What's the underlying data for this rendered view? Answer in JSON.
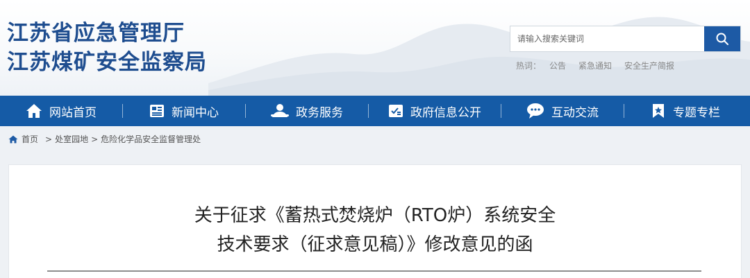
{
  "site": {
    "title_line1": "江苏省应急管理厅",
    "title_line2": "江苏煤矿安全监察局"
  },
  "search": {
    "placeholder": "请输入搜索关键词",
    "button_icon": "search-icon"
  },
  "hot_words": {
    "label": "热词：",
    "items": [
      "公告",
      "紧急通知",
      "安全生产简报"
    ]
  },
  "nav": {
    "items": [
      {
        "label": "网站首页",
        "icon": "home-icon"
      },
      {
        "label": "新闻中心",
        "icon": "news-icon"
      },
      {
        "label": "政务服务",
        "icon": "service-icon"
      },
      {
        "label": "政府信息公开",
        "icon": "info-public-icon"
      },
      {
        "label": "互动交流",
        "icon": "chat-icon"
      },
      {
        "label": "专题专栏",
        "icon": "bookmark-icon"
      }
    ]
  },
  "breadcrumb": {
    "items": [
      "首页",
      "处室园地",
      "危险化学品安全监督管理处"
    ],
    "separator": ">"
  },
  "article": {
    "title_line1": "关于征求《蓄热式焚烧炉（RTO炉）系统安全",
    "title_line2": "技术要求（征求意见稿）》修改意见的函"
  },
  "colors": {
    "brand_blue": "#155ba6",
    "logo_blue": "#1e4d8f"
  }
}
